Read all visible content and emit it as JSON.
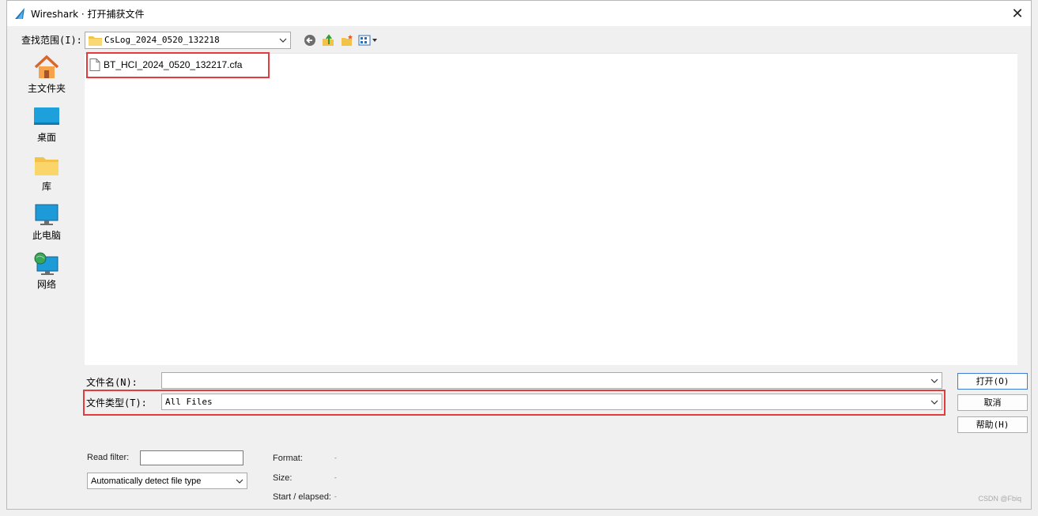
{
  "window": {
    "title": "Wireshark · 打开捕获文件"
  },
  "lookin": {
    "label": "查找范围(I):",
    "folder": "CsLog_2024_0520_132218"
  },
  "places": [
    {
      "label": "主文件夹",
      "icon": "home-icon"
    },
    {
      "label": "桌面",
      "icon": "desktop-icon"
    },
    {
      "label": "库",
      "icon": "library-folder-icon"
    },
    {
      "label": "此电脑",
      "icon": "computer-icon"
    },
    {
      "label": "网络",
      "icon": "network-icon"
    }
  ],
  "files": [
    {
      "name": "BT_HCI_2024_0520_132217.cfa",
      "icon": "document-icon"
    }
  ],
  "filename": {
    "label": "文件名(N):",
    "value": ""
  },
  "filetype": {
    "label": "文件类型(T):",
    "value": "All Files"
  },
  "buttons": {
    "open": "打开(O)",
    "cancel": "取消",
    "help": "帮助(H)"
  },
  "readfilter": {
    "label": "Read filter:",
    "value": ""
  },
  "format_detect": {
    "value": "Automatically detect file type"
  },
  "info": {
    "format_label": "Format:",
    "format_value": "-",
    "size_label": "Size:",
    "size_value": "-",
    "start_label": "Start / elapsed:",
    "start_value": "-"
  },
  "watermark": "CSDN @Fbiq"
}
